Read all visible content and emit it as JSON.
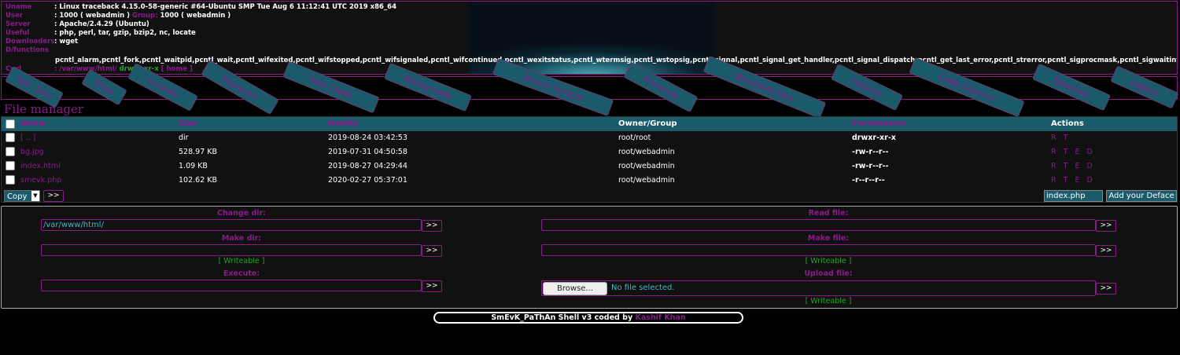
{
  "header": {
    "uname_label": "Uname",
    "uname": ": Linux traceback 4.15.0-58-generic #64-Ubuntu SMP Tue Aug 6 11:12:41 UTC 2019 x86_64",
    "user_label": "User",
    "user": ": 1000 ( webadmin )",
    "group_label": "Group:",
    "group": "1000 ( webadmin )",
    "server_label": "Server",
    "server": ": Apache/2.4.29 (Ubuntu)",
    "useful_label": "Useful",
    "useful": ": php, perl, tar, gzip, bzip2, nc, locate",
    "downloaders_label": "Downloaders",
    "downloaders": ": wget",
    "dfunctions_label": "D/functions",
    "dfunctions": "pcntl_alarm,pcntl_fork,pcntl_waitpid,pcntl_wait,pcntl_wifexited,pcntl_wifstopped,pcntl_wifsignaled,pcntl_wifcontinued,pcntl_wexitstatus,pcntl_wtermsig,pcntl_wstopsig,pcntl_signal,pcntl_signal_get_handler,pcntl_signal_dispatch,pcntl_get_last_error,pcntl_strerror,pcntl_sigprocmask,pcntl_sigwaitinfo",
    "cwd_label": "Cwd",
    "cwd": ": /var/www/html/",
    "cwd_perm": "drwxr-xr-x",
    "cwd_home": "[ home ]"
  },
  "menu": [
    "Sec. Info",
    "Files",
    "Console",
    "Bypasser",
    "Safe Mode",
    "String tools",
    "Bruter Scripts",
    "Network",
    "Readable Dirs",
    "Defacer",
    "Code Injector",
    "Domains",
    "Logout"
  ],
  "file_manager": {
    "title": "File manager",
    "columns": [
      "Name",
      "Size",
      "Modify",
      "Owner/Group",
      "Permissions",
      "Actions"
    ],
    "rows": [
      {
        "name": "[ .. ]",
        "size": "dir",
        "modify": "2019-08-24 03:42:53",
        "owner": "root/root",
        "perms": "drwxr-xr-x",
        "actions": "R T"
      },
      {
        "name": "bg.jpg",
        "size": "528.97 KB",
        "modify": "2019-07-31 04:50:58",
        "owner": "root/webadmin",
        "perms": "-rw-r--r--",
        "actions": "R T E D"
      },
      {
        "name": "index.html",
        "size": "1.09 KB",
        "modify": "2019-08-27 04:29:44",
        "owner": "root/webadmin",
        "perms": "-rw-r--r--",
        "actions": "R T E D"
      },
      {
        "name": "smevk.php",
        "size": "102.62 KB",
        "modify": "2020-02-27 05:37:01",
        "owner": "root/webadmin",
        "perms": "-r--r--r--",
        "actions": "R T E D"
      }
    ],
    "copy_option": "Copy",
    "go_label": ">>",
    "deface_file": "index.php",
    "deface_button": "Add your Deface"
  },
  "tools": {
    "change_dir_label": "Change dir:",
    "change_dir_value": "/var/www/html/",
    "read_file_label": "Read file:",
    "make_dir_label": "Make dir:",
    "make_file_label": "Make file:",
    "writeable": "[ Writeable ]",
    "execute_label": "Execute:",
    "upload_file_label": "Upload file:",
    "browse_label": "Browse...",
    "no_file": "No file selected.",
    "go": ">>"
  },
  "footer": {
    "text": "SmEvK_PaThAn Shell v3 coded by",
    "author": "Kashif Khan"
  },
  "colors": {
    "accent": "#8b1a8b",
    "teal": "#1a5a6a",
    "green": "#2aa02a",
    "background": "#000000"
  }
}
